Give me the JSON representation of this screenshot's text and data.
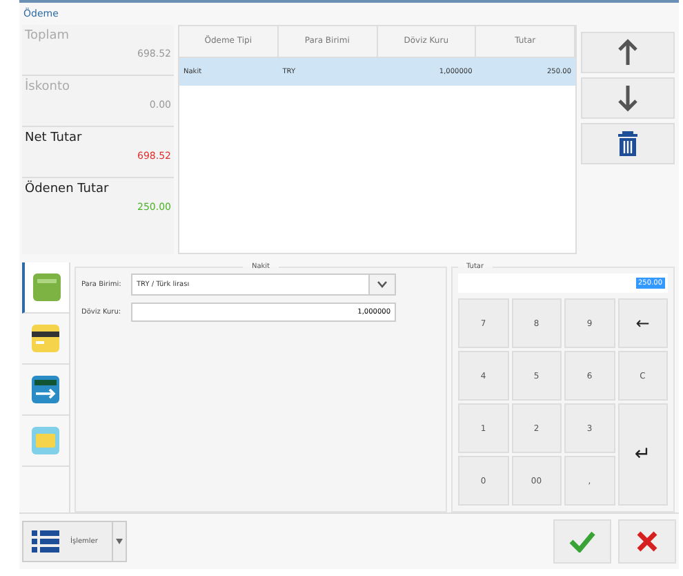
{
  "window": {
    "title": "Ödeme"
  },
  "summary": [
    {
      "label": "Toplam",
      "value": "698.52",
      "kind": "muted"
    },
    {
      "label": "İskonto",
      "value": "0.00",
      "kind": "muted"
    },
    {
      "label": "Net Tutar",
      "value": "698.52",
      "kind": "due"
    },
    {
      "label": "Ödenen Tutar",
      "value": "250.00",
      "kind": "paid"
    }
  ],
  "table": {
    "columns": [
      "Ödeme Tipi",
      "Para Birimi",
      "Döviz Kuru",
      "Tutar"
    ],
    "rows": [
      {
        "cells": [
          "Nakit",
          "TRY",
          "1,000000",
          "250.00"
        ],
        "selected": true
      }
    ]
  },
  "side_buttons": [
    {
      "kind": "up"
    },
    {
      "kind": "down"
    },
    {
      "kind": "delete"
    }
  ],
  "payment_tabs": [
    {
      "kind": "cash",
      "selected": true
    },
    {
      "kind": "card",
      "selected": false
    },
    {
      "kind": "transfer",
      "selected": false
    },
    {
      "kind": "voucher",
      "selected": false
    }
  ],
  "detail": {
    "title": "Nakit",
    "currency_label": "Para Birimi:",
    "currency_value": "TRY / Türk lirası",
    "rate_label": "Döviz Kuru:",
    "rate_value": "1,000000"
  },
  "amount": {
    "title": "Tutar",
    "value": "250.00"
  },
  "keypad": [
    {
      "label": "7",
      "kind": "key"
    },
    {
      "label": "8",
      "kind": "key"
    },
    {
      "label": "9",
      "kind": "key"
    },
    {
      "label": "←",
      "kind": "key"
    },
    {
      "label": "4",
      "kind": "key"
    },
    {
      "label": "5",
      "kind": "key"
    },
    {
      "label": "6",
      "kind": "key"
    },
    {
      "label": "C",
      "kind": "key"
    },
    {
      "label": "1",
      "kind": "key"
    },
    {
      "label": "2",
      "kind": "key"
    },
    {
      "label": "3",
      "kind": "key"
    },
    {
      "label": "↵",
      "kind": "enter"
    },
    {
      "label": "0",
      "kind": "key"
    },
    {
      "label": "00",
      "kind": "key"
    },
    {
      "label": ",",
      "kind": "key"
    }
  ],
  "footer": {
    "menu_label": "İşlemler"
  }
}
